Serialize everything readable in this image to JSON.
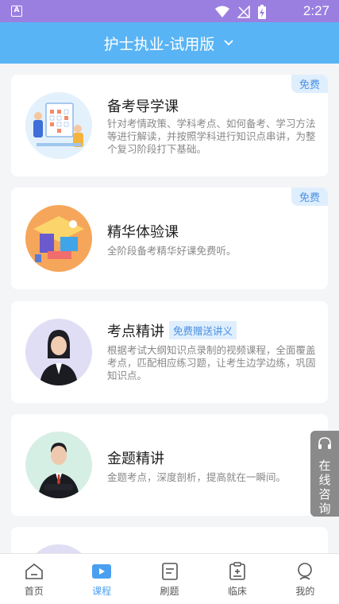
{
  "status_bar": {
    "time": "2:27"
  },
  "header": {
    "title": "护士执业-试用版"
  },
  "courses": [
    {
      "title": "备考导学课",
      "badge": "免费",
      "desc": "针对考情政策、学科考点、如何备考、学习方法等进行解读，并按照学科进行知识点串讲，为整个复习阶段打下基础。"
    },
    {
      "title": "精华体验课",
      "badge": "免费",
      "desc": "全阶段备考精华好课免费听。"
    },
    {
      "title": "考点精讲",
      "tag": "免费赠送讲义",
      "desc": "根据考试大纲知识点录制的视频课程，全面覆盖考点，匹配相应练习题，让考生边学边练，巩固知识点。"
    },
    {
      "title": "金题精讲",
      "desc": "金题考点，深度剖析，提高就在一瞬间。"
    }
  ],
  "consult": {
    "label": "在线咨询"
  },
  "tabs": [
    {
      "label": "首页",
      "icon": "home-icon"
    },
    {
      "label": "课程",
      "icon": "play-icon",
      "active": true
    },
    {
      "label": "刷题",
      "icon": "question-icon"
    },
    {
      "label": "临床",
      "icon": "clipboard-icon"
    },
    {
      "label": "我的",
      "icon": "person-icon"
    }
  ],
  "colors": {
    "header": "#59b4f5",
    "status_bar": "#9b7fe0",
    "accent": "#4a9ff0",
    "badge_bg": "#dfeefd"
  }
}
